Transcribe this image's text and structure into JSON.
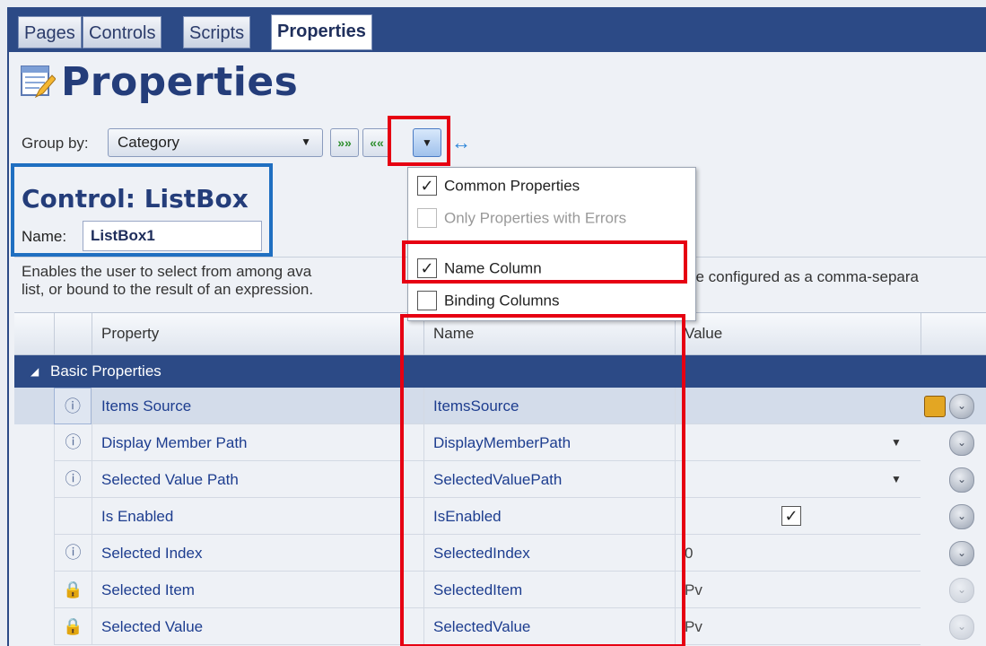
{
  "tabs": [
    "Pages",
    "Controls",
    "Scripts",
    "Properties"
  ],
  "header": {
    "title": "Properties"
  },
  "toolbar": {
    "group_by_label": "Group by:",
    "group_by_value": "Category"
  },
  "control": {
    "title": "Control: ListBox",
    "name_label": "Name:",
    "name_value": "ListBox1"
  },
  "description": {
    "line1_start": "Enables the user to select from among ava",
    "line1_end": "be configured as a comma-separa",
    "line2": "list, or bound to the result of an expression."
  },
  "menu": {
    "items": [
      {
        "label": "Common Properties",
        "checked": true,
        "disabled": false
      },
      {
        "label": "Only Properties with Errors",
        "checked": false,
        "disabled": true
      },
      {
        "label": "Name Column",
        "checked": true,
        "disabled": false
      },
      {
        "label": "Binding Columns",
        "checked": false,
        "disabled": false
      }
    ]
  },
  "grid": {
    "headers": {
      "property": "Property",
      "name": "Name",
      "value": "Value"
    },
    "group": "Basic Properties",
    "rows": [
      {
        "property": "Items Source",
        "name": "ItemsSource",
        "value": "",
        "icon": "info-icon"
      },
      {
        "property": "Display Member Path",
        "name": "DisplayMemberPath",
        "value": "",
        "icon": "info-icon"
      },
      {
        "property": "Selected Value Path",
        "name": "SelectedValuePath",
        "value": "",
        "icon": "info-icon"
      },
      {
        "property": "Is Enabled",
        "name": "IsEnabled",
        "value": "",
        "icon": ""
      },
      {
        "property": "Selected Index",
        "name": "SelectedIndex",
        "value": "0",
        "icon": "info-icon"
      },
      {
        "property": "Selected Item",
        "name": "SelectedItem",
        "value": "Pv",
        "icon": "lock-icon"
      },
      {
        "property": "Selected Value",
        "name": "SelectedValue",
        "value": "Pv",
        "icon": "lock-icon"
      }
    ]
  }
}
